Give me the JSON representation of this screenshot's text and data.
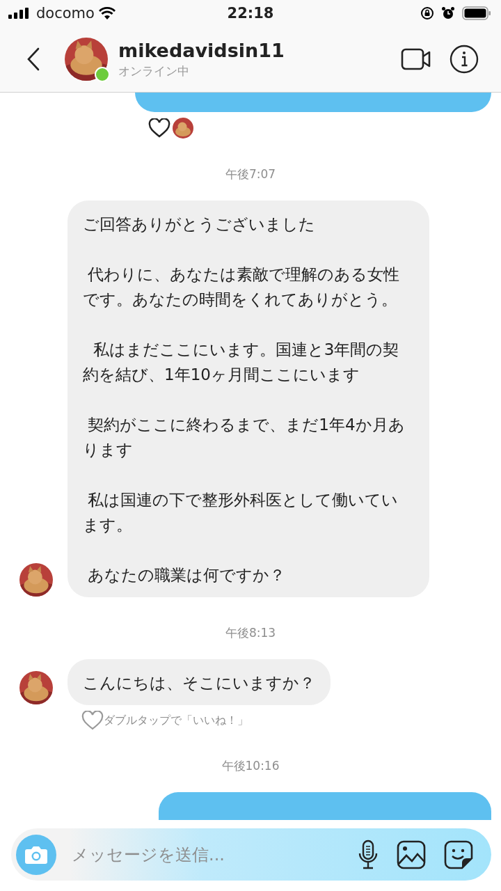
{
  "status_bar": {
    "carrier": "docomo",
    "time": "22:18"
  },
  "header": {
    "username": "mikedavidsin11",
    "status": "オンライン中",
    "online": true
  },
  "feed": [
    {
      "kind": "outgoing",
      "liked": true
    },
    {
      "kind": "timestamp",
      "text": "午後7:07"
    },
    {
      "kind": "incoming",
      "paragraphs": [
        "ご回答ありがとうございました",
        " 代わりに、あなたは素敵で理解のある女性です。あなたの時間をくれてありがとう。",
        "  私はまだここにいます。国連と3年間の契約を結び、1年10ヶ月間ここにいます",
        " 契約がここに終わるまで、まだ1年4か月あります",
        " 私は国連の下で整形外科医として働いています。",
        " あなたの職業は何ですか？"
      ]
    },
    {
      "kind": "timestamp",
      "text": "午後8:13"
    },
    {
      "kind": "incoming",
      "paragraphs": [
        "こんにちは、そこにいますか？"
      ],
      "hint": "ダブルタップで「いいね！」"
    },
    {
      "kind": "timestamp",
      "text": "午後10:16"
    },
    {
      "kind": "outgoing_peek"
    }
  ],
  "composer": {
    "placeholder": "メッセージを送信..."
  }
}
